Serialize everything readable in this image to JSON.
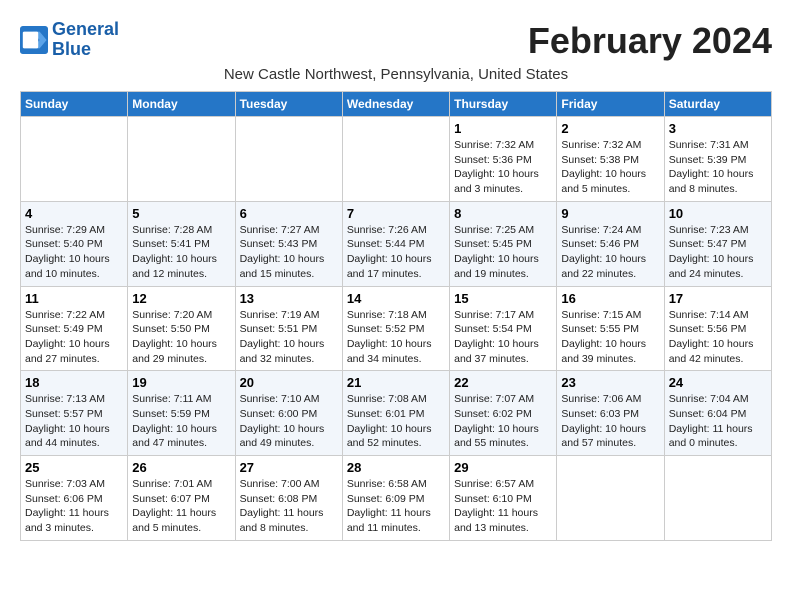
{
  "header": {
    "logo_line1": "General",
    "logo_line2": "Blue",
    "month_year": "February 2024",
    "location": "New Castle Northwest, Pennsylvania, United States"
  },
  "weekdays": [
    "Sunday",
    "Monday",
    "Tuesday",
    "Wednesday",
    "Thursday",
    "Friday",
    "Saturday"
  ],
  "weeks": [
    [
      {
        "day": "",
        "info": ""
      },
      {
        "day": "",
        "info": ""
      },
      {
        "day": "",
        "info": ""
      },
      {
        "day": "",
        "info": ""
      },
      {
        "day": "1",
        "info": "Sunrise: 7:32 AM\nSunset: 5:36 PM\nDaylight: 10 hours\nand 3 minutes."
      },
      {
        "day": "2",
        "info": "Sunrise: 7:32 AM\nSunset: 5:38 PM\nDaylight: 10 hours\nand 5 minutes."
      },
      {
        "day": "3",
        "info": "Sunrise: 7:31 AM\nSunset: 5:39 PM\nDaylight: 10 hours\nand 8 minutes."
      }
    ],
    [
      {
        "day": "4",
        "info": "Sunrise: 7:29 AM\nSunset: 5:40 PM\nDaylight: 10 hours\nand 10 minutes."
      },
      {
        "day": "5",
        "info": "Sunrise: 7:28 AM\nSunset: 5:41 PM\nDaylight: 10 hours\nand 12 minutes."
      },
      {
        "day": "6",
        "info": "Sunrise: 7:27 AM\nSunset: 5:43 PM\nDaylight: 10 hours\nand 15 minutes."
      },
      {
        "day": "7",
        "info": "Sunrise: 7:26 AM\nSunset: 5:44 PM\nDaylight: 10 hours\nand 17 minutes."
      },
      {
        "day": "8",
        "info": "Sunrise: 7:25 AM\nSunset: 5:45 PM\nDaylight: 10 hours\nand 19 minutes."
      },
      {
        "day": "9",
        "info": "Sunrise: 7:24 AM\nSunset: 5:46 PM\nDaylight: 10 hours\nand 22 minutes."
      },
      {
        "day": "10",
        "info": "Sunrise: 7:23 AM\nSunset: 5:47 PM\nDaylight: 10 hours\nand 24 minutes."
      }
    ],
    [
      {
        "day": "11",
        "info": "Sunrise: 7:22 AM\nSunset: 5:49 PM\nDaylight: 10 hours\nand 27 minutes."
      },
      {
        "day": "12",
        "info": "Sunrise: 7:20 AM\nSunset: 5:50 PM\nDaylight: 10 hours\nand 29 minutes."
      },
      {
        "day": "13",
        "info": "Sunrise: 7:19 AM\nSunset: 5:51 PM\nDaylight: 10 hours\nand 32 minutes."
      },
      {
        "day": "14",
        "info": "Sunrise: 7:18 AM\nSunset: 5:52 PM\nDaylight: 10 hours\nand 34 minutes."
      },
      {
        "day": "15",
        "info": "Sunrise: 7:17 AM\nSunset: 5:54 PM\nDaylight: 10 hours\nand 37 minutes."
      },
      {
        "day": "16",
        "info": "Sunrise: 7:15 AM\nSunset: 5:55 PM\nDaylight: 10 hours\nand 39 minutes."
      },
      {
        "day": "17",
        "info": "Sunrise: 7:14 AM\nSunset: 5:56 PM\nDaylight: 10 hours\nand 42 minutes."
      }
    ],
    [
      {
        "day": "18",
        "info": "Sunrise: 7:13 AM\nSunset: 5:57 PM\nDaylight: 10 hours\nand 44 minutes."
      },
      {
        "day": "19",
        "info": "Sunrise: 7:11 AM\nSunset: 5:59 PM\nDaylight: 10 hours\nand 47 minutes."
      },
      {
        "day": "20",
        "info": "Sunrise: 7:10 AM\nSunset: 6:00 PM\nDaylight: 10 hours\nand 49 minutes."
      },
      {
        "day": "21",
        "info": "Sunrise: 7:08 AM\nSunset: 6:01 PM\nDaylight: 10 hours\nand 52 minutes."
      },
      {
        "day": "22",
        "info": "Sunrise: 7:07 AM\nSunset: 6:02 PM\nDaylight: 10 hours\nand 55 minutes."
      },
      {
        "day": "23",
        "info": "Sunrise: 7:06 AM\nSunset: 6:03 PM\nDaylight: 10 hours\nand 57 minutes."
      },
      {
        "day": "24",
        "info": "Sunrise: 7:04 AM\nSunset: 6:04 PM\nDaylight: 11 hours\nand 0 minutes."
      }
    ],
    [
      {
        "day": "25",
        "info": "Sunrise: 7:03 AM\nSunset: 6:06 PM\nDaylight: 11 hours\nand 3 minutes."
      },
      {
        "day": "26",
        "info": "Sunrise: 7:01 AM\nSunset: 6:07 PM\nDaylight: 11 hours\nand 5 minutes."
      },
      {
        "day": "27",
        "info": "Sunrise: 7:00 AM\nSunset: 6:08 PM\nDaylight: 11 hours\nand 8 minutes."
      },
      {
        "day": "28",
        "info": "Sunrise: 6:58 AM\nSunset: 6:09 PM\nDaylight: 11 hours\nand 11 minutes."
      },
      {
        "day": "29",
        "info": "Sunrise: 6:57 AM\nSunset: 6:10 PM\nDaylight: 11 hours\nand 13 minutes."
      },
      {
        "day": "",
        "info": ""
      },
      {
        "day": "",
        "info": ""
      }
    ]
  ]
}
